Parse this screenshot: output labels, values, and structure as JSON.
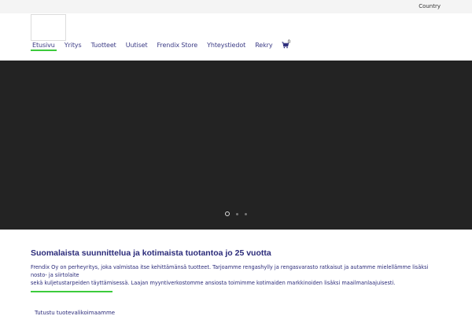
{
  "topbar": {
    "country_label": "Country"
  },
  "nav": {
    "items": [
      {
        "label": "Etusivu"
      },
      {
        "label": "Yritys"
      },
      {
        "label": "Tuotteet"
      },
      {
        "label": "Uutiset"
      },
      {
        "label": "Frendix Store"
      },
      {
        "label": "Yhteystiedot"
      },
      {
        "label": "Rekry"
      }
    ],
    "active_item": "Etusivu",
    "cart_count": "0"
  },
  "hero": {
    "slide_count": 3,
    "active_slide": 1
  },
  "main": {
    "title": "Suomalaista suunnittelua ja kotimaista tuotantoa jo 25 vuotta",
    "paragraph_line1": "Frendix Oy on perheyritys, joka valmistaa itse kehittämänsä tuotteet. Tarjoamme rengashylly ja rengasvarasto ratkaisut ja autamme mielellämme lisäksi nosto- ja siirtolaite",
    "paragraph_line2": "sekä kuljetustarpeiden täyttämisessä. Laajan myyntiverkostomme ansiosta toimimme kotimaiden markkinoiden lisäksi maailmanlaajuisesti.",
    "subheading": "Tutustu tuotevalikoimaamme"
  },
  "colors": {
    "accent": "#3ccb3c",
    "text": "#2b2b7a",
    "hero_bg": "#232323"
  }
}
